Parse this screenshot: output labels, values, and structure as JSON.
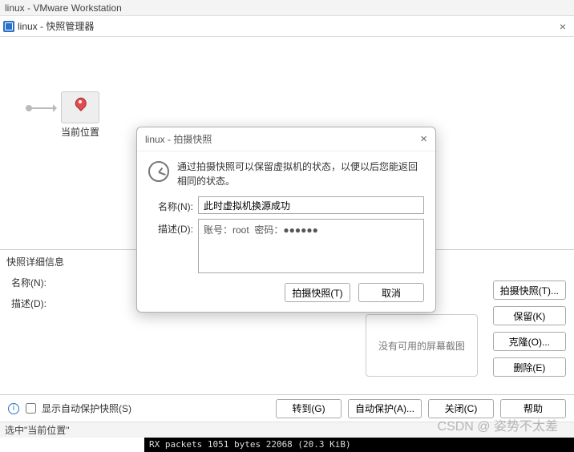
{
  "app": {
    "title": "linux - VMware Workstation"
  },
  "tab": {
    "label": "linux - 快照管理器"
  },
  "snapshot_node": {
    "label": "当前位置"
  },
  "details": {
    "section_title": "快照详细信息",
    "name_label": "名称(N):",
    "desc_label": "描述(D):",
    "thumb_placeholder": "没有可用的屏幕截图"
  },
  "side_buttons": {
    "take": "拍摄快照(T)...",
    "keep": "保留(K)",
    "clone": "克隆(O)...",
    "delete": "删除(E)"
  },
  "bottom": {
    "auto_protect_chk": "显示自动保护快照(S)",
    "goto": "转到(G)",
    "auto_protect": "自动保护(A)...",
    "close": "关闭(C)",
    "help": "帮助"
  },
  "status": {
    "text": "选中\"当前位置\""
  },
  "terminal": {
    "text": "RX packets 1051  bytes 22068 (20.3 KiB)"
  },
  "watermark": "CSDN @ 姿势不太差",
  "modal": {
    "title": "linux - 拍摄快照",
    "intro": "通过拍摄快照可以保留虚拟机的状态，以便以后您能返回相同的状态。",
    "name_label": "名称(N):",
    "name_value": "此时虚拟机换源成功",
    "desc_label": "描述(D):",
    "desc_value": "账号：root  密码：●●●●●●",
    "take": "拍摄快照(T)",
    "cancel": "取消"
  }
}
